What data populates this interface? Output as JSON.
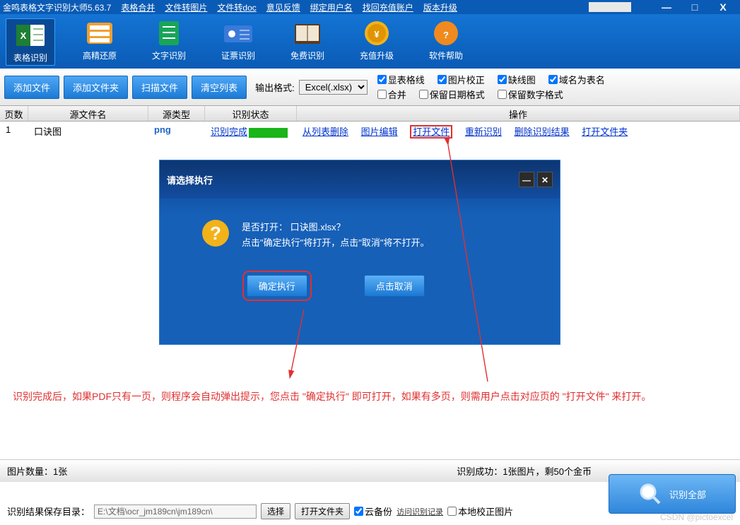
{
  "title": "金鸣表格文字识别大师5.63.7",
  "menus": [
    "表格合并",
    "文件转图片",
    "文件转doc",
    "意见反馈",
    "绑定用户名",
    "找回充值账户",
    "版本升级"
  ],
  "winbtns": {
    "min": "—",
    "max": "□",
    "close": "X"
  },
  "ribbon": [
    {
      "name": "table-recog",
      "label": "表格识别",
      "active": true
    },
    {
      "name": "hi-restore",
      "label": "高精还原"
    },
    {
      "name": "text-recog",
      "label": "文字识别"
    },
    {
      "name": "id-recog",
      "label": "证票识别"
    },
    {
      "name": "free-recog",
      "label": "免费识别"
    },
    {
      "name": "topup",
      "label": "充值升级"
    },
    {
      "name": "help",
      "label": "软件帮助"
    }
  ],
  "actions": {
    "add_file": "添加文件",
    "add_folder": "添加文件夹",
    "scan": "扫描文件",
    "clear": "清空列表"
  },
  "output": {
    "label": "输出格式:",
    "value": "Excel(.xlsx)"
  },
  "checks": {
    "grid": "显表格线",
    "imgfix": "图片校正",
    "missline": "缺线图",
    "domain": "域名为表名",
    "merge": "合并",
    "keepdate": "保留日期格式",
    "keepnum": "保留数字格式"
  },
  "cols": {
    "page": "页数",
    "file": "源文件名",
    "type": "源类型",
    "stat": "识别状态",
    "ops": "操作"
  },
  "row": {
    "page": "1",
    "file": "口诀图",
    "type": "png",
    "stat": "识别完成",
    "ops": [
      "从列表删除",
      "图片编辑",
      "打开文件",
      "重新识别",
      "删除识别结果",
      "打开文件夹"
    ]
  },
  "dialog": {
    "title": "请选择执行",
    "line1": "是否打开：  口诀图.xlsx？",
    "line2": "点击\"确定执行\"将打开，点击\"取消\"将不打开。",
    "ok": "确定执行",
    "cancel": "点击取消"
  },
  "annot": "识别完成后，如果PDF只有一页，则程序会自动弹出提示，您点击 \"确定执行\" 即可打开，如果有多页，则需用户点击对应页的 \"打开文件\" 来打开。",
  "bottom": {
    "count": "图片数量：1张",
    "success": "识别成功：1张图片，剩50个金币",
    "save_label": "识别结果保存目录：",
    "path": "E:\\文档\\ocr_jm189cn\\jm189cn\\",
    "choose": "选择",
    "open_folder": "打开文件夹",
    "cloud": "云备份",
    "visit": "访问识别记录",
    "local": "本地校正图片",
    "recog_all": "识别全部"
  },
  "watermark": "CSDN @pictoexcel"
}
